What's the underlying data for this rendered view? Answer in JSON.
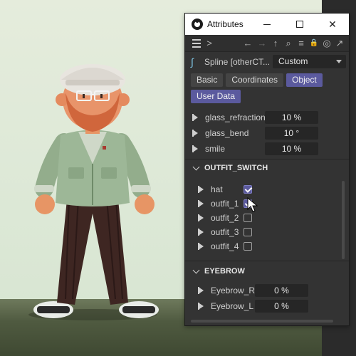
{
  "window": {
    "title": "Attributes"
  },
  "window_controls": {
    "minimize": "—",
    "maximize": "☐",
    "close": "✕"
  },
  "toolbar": {
    "more": ">",
    "back": "←",
    "forward": "→",
    "up": "↑",
    "search": "⌕",
    "filter": "≡",
    "lock": "🔒",
    "target": "◎",
    "new_window": "↗"
  },
  "object": {
    "name": "Spline [otherCT...",
    "mode": "Custom"
  },
  "tabs": [
    "Basic",
    "Coordinates",
    "Object",
    "User Data"
  ],
  "active_tab": "Object",
  "properties": [
    {
      "label": "glass_refraction",
      "value": "10 %"
    },
    {
      "label": "glass_bend",
      "value": "10 °"
    },
    {
      "label": "smile",
      "value": "10 %"
    }
  ],
  "groups": {
    "outfit": {
      "title": "OUTFIT_SWITCH",
      "items": [
        {
          "label": "hat",
          "checked": true
        },
        {
          "label": "outfit_1",
          "checked": true
        },
        {
          "label": "outfit_2",
          "checked": false
        },
        {
          "label": "outfit_3",
          "checked": false
        },
        {
          "label": "outfit_4",
          "checked": false
        }
      ]
    },
    "eyebrow": {
      "title": "EYEBROW",
      "items": [
        {
          "label": "Eyebrow_R",
          "value": "0 %"
        },
        {
          "label": "Eyebrow_L",
          "value": "0 %"
        }
      ]
    }
  },
  "colors": {
    "panel_bg": "#333333",
    "accent": "#5b5a9e",
    "field_bg": "#262626",
    "spline_icon": "#7fc7e6"
  }
}
